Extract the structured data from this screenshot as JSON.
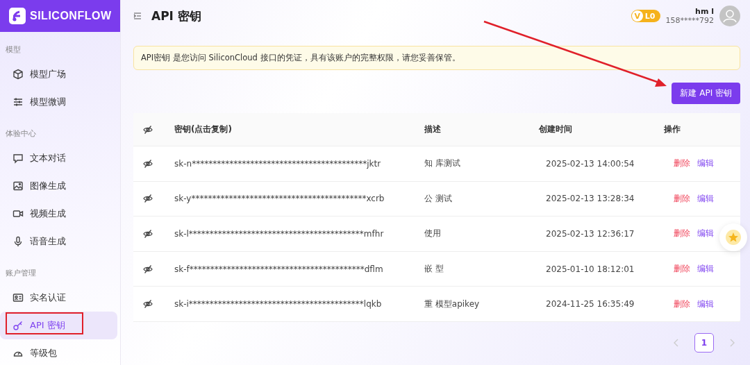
{
  "logo": {
    "text": "SILICONFLOW"
  },
  "sidebar": {
    "sections": [
      {
        "heading": "模型",
        "items": [
          {
            "label": "模型广场",
            "selected": false
          },
          {
            "label": "模型微调",
            "selected": false
          }
        ]
      },
      {
        "heading": "体验中心",
        "items": [
          {
            "label": "文本对话",
            "selected": false
          },
          {
            "label": "图像生成",
            "selected": false
          },
          {
            "label": "视频生成",
            "selected": false
          },
          {
            "label": "语音生成",
            "selected": false
          }
        ]
      },
      {
        "heading": "账户管理",
        "items": [
          {
            "label": "实名认证",
            "selected": false
          },
          {
            "label": "API 密钥",
            "selected": true
          },
          {
            "label": "等级包",
            "selected": false
          }
        ]
      }
    ]
  },
  "header": {
    "title": "API 密钥",
    "level_mark": "V",
    "level_badge": "L0",
    "user_name": "hm l",
    "user_phone": "158*****792"
  },
  "notice": "API密钥 是您访问 SiliconCloud 接口的凭证，具有该账户的完整权限，请您妥善保管。",
  "new_key_button": "新建 API 密钥",
  "table": {
    "columns": [
      "密钥(点击复制)",
      "描述",
      "创建时间",
      "操作"
    ],
    "rows": [
      {
        "key": "sk-n******************************************jktr",
        "description": "知 库测试",
        "created": "2025-02-13 14:00:54",
        "actions": [
          "删除",
          "编辑"
        ]
      },
      {
        "key": "sk-y******************************************xcrb",
        "description": "公 测试",
        "created": "2025-02-13 13:28:34",
        "actions": [
          "删除",
          "编辑"
        ]
      },
      {
        "key": "sk-l******************************************mfhr",
        "description": "使用",
        "created": "2025-02-13 12:36:17",
        "actions": [
          "删除",
          "编辑"
        ]
      },
      {
        "key": "sk-f******************************************dflm",
        "description": "嵌 型",
        "created": "2025-01-10 18:12:01",
        "actions": [
          "删除",
          "编辑"
        ]
      },
      {
        "key": "sk-i******************************************lqkb",
        "description": "重 模型apikey",
        "created": "2024-11-25 16:35:49",
        "actions": [
          "删除",
          "编辑"
        ]
      }
    ]
  },
  "pagination": {
    "pages": [
      {
        "label": "1",
        "selected": true
      }
    ]
  }
}
